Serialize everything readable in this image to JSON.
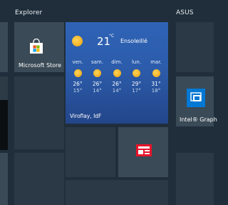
{
  "groups": {
    "left_label": "Explorer",
    "right_label": "ASUS"
  },
  "tiles": {
    "store_label": "Microsoft Store",
    "intel_label": "Intel® Graph"
  },
  "weather": {
    "current_temp": "21",
    "unit": "°C",
    "condition": "Ensoleillé",
    "location": "Viroflay, IdF",
    "forecast": [
      {
        "day": "ven.",
        "high": "26°",
        "low": "15°"
      },
      {
        "day": "sam.",
        "high": "26°",
        "low": "14°"
      },
      {
        "day": "dim.",
        "high": "26°",
        "low": "14°"
      },
      {
        "day": "lun.",
        "high": "29°",
        "low": "17°"
      },
      {
        "day": "mar.",
        "high": "31°",
        "low": "18°"
      }
    ]
  },
  "icons": {
    "store": "shopping-bag-icon",
    "sun": "sun-icon",
    "intel": "intel-graphics-icon",
    "app": "red-app-icon"
  },
  "colors": {
    "background": "#1f2e3a",
    "tile": "#3a4a56",
    "weather_top": "#2f63b6",
    "accent_blue": "#0078d4",
    "sun": "#f4b020"
  }
}
